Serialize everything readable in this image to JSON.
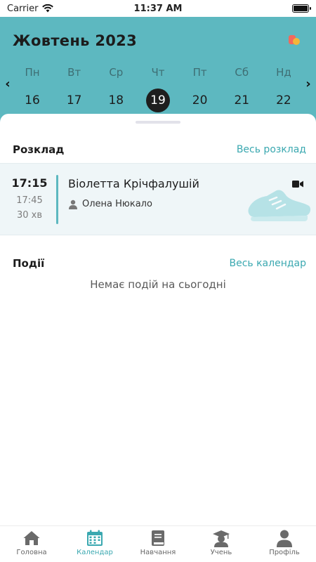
{
  "status": {
    "carrier": "Carrier",
    "time": "11:37 AM"
  },
  "header": {
    "month_title": "Жовтень 2023",
    "prev_glyph": "‹",
    "next_glyph": "›",
    "days": [
      {
        "name": "Пн",
        "num": "16"
      },
      {
        "name": "Вт",
        "num": "17"
      },
      {
        "name": "Ср",
        "num": "18"
      },
      {
        "name": "Чт",
        "num": "19",
        "selected": true
      },
      {
        "name": "Пт",
        "num": "20"
      },
      {
        "name": "Сб",
        "num": "21"
      },
      {
        "name": "Нд",
        "num": "22"
      }
    ],
    "colors": {
      "background": "#5db8c0",
      "selected_day": "#1e1e1e"
    }
  },
  "schedule": {
    "title": "Розклад",
    "link": "Весь розклад",
    "lesson": {
      "start": "17:15",
      "end": "17:45",
      "duration": "30 хв",
      "name": "Віолетта Крічфалушій",
      "teacher": "Олена Нюкало",
      "icons": [
        "person-icon",
        "video-camera-icon",
        "sneaker-illustration"
      ]
    }
  },
  "events": {
    "title": "Події",
    "link": "Весь календар",
    "empty": "Немає подій на сьогодні"
  },
  "tabbar": {
    "items": [
      {
        "label": "Головна",
        "icon": "home-icon"
      },
      {
        "label": "Календар",
        "icon": "calendar-icon",
        "active": true
      },
      {
        "label": "Навчання",
        "icon": "book-icon"
      },
      {
        "label": "Учень",
        "icon": "student-icon"
      },
      {
        "label": "Профіль",
        "icon": "profile-icon"
      }
    ],
    "colors": {
      "active": "#3aa8b0",
      "inactive": "#666666"
    }
  }
}
